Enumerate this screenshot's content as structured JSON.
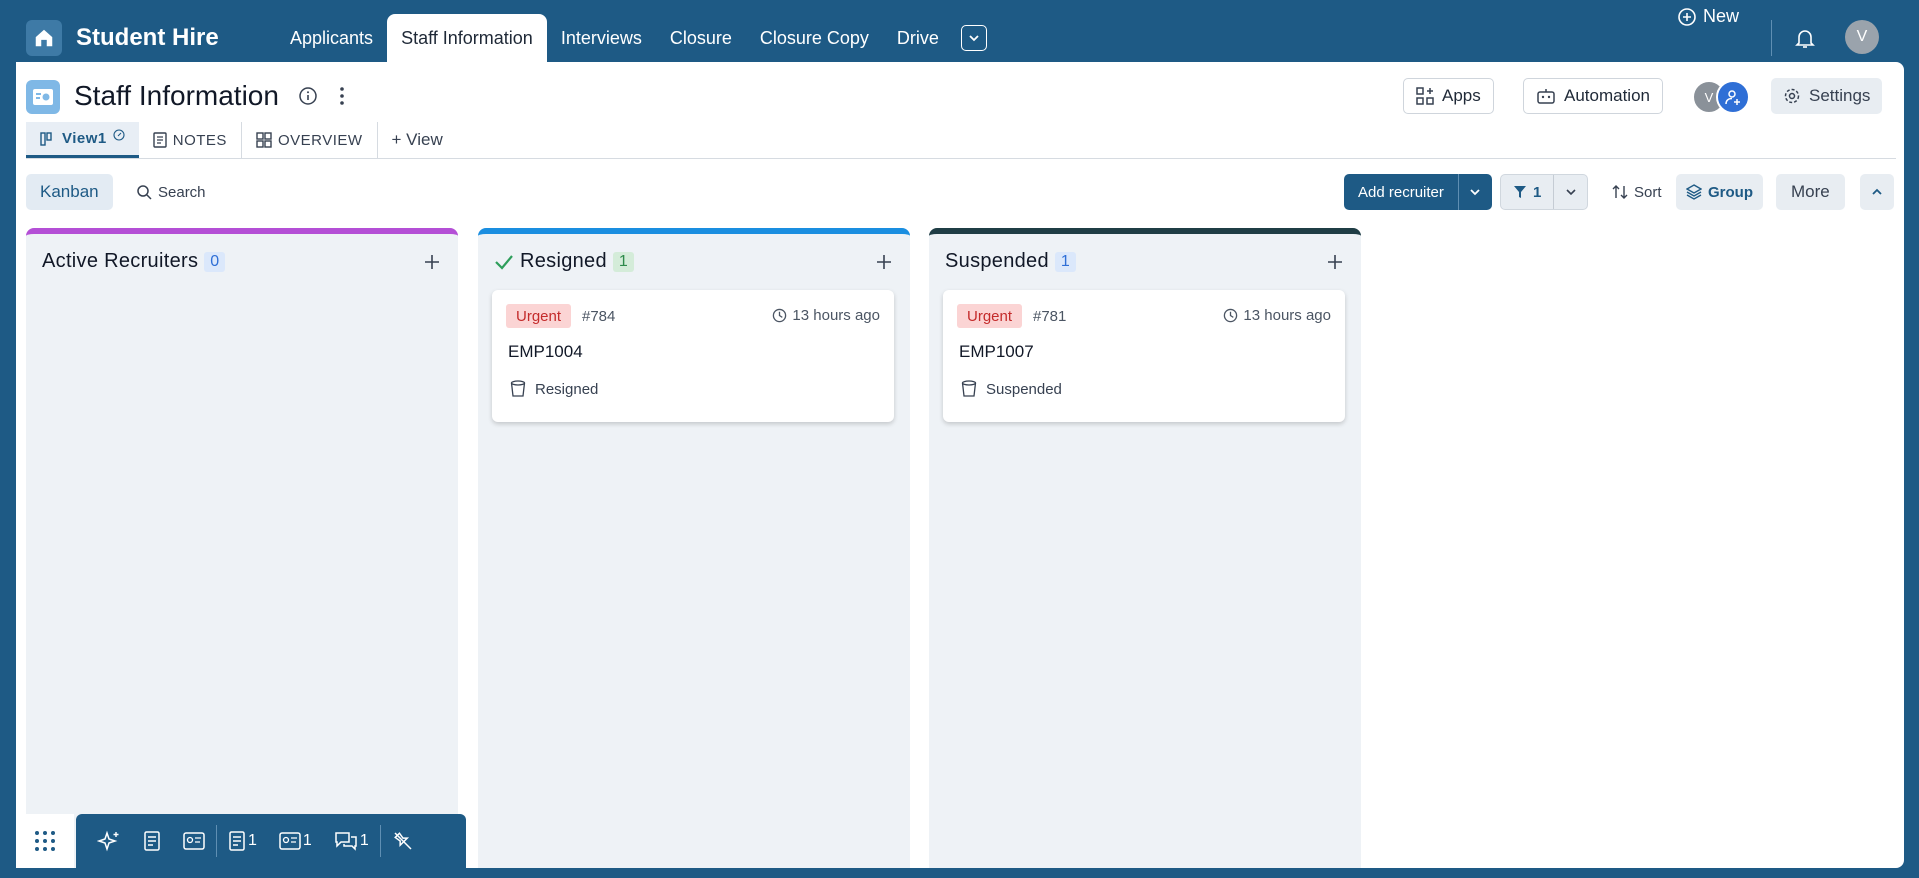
{
  "app": {
    "title": "Student Hire"
  },
  "nav": {
    "tabs": [
      {
        "label": "Applicants"
      },
      {
        "label": "Staff Information"
      },
      {
        "label": "Interviews"
      },
      {
        "label": "Closure"
      },
      {
        "label": "Closure Copy"
      },
      {
        "label": "Drive"
      }
    ],
    "new_label": "New",
    "avatar_initial": "V"
  },
  "page": {
    "title": "Staff Information",
    "apps_label": "Apps",
    "automation_label": "Automation",
    "settings_label": "Settings",
    "avatar_initial": "V"
  },
  "views": {
    "tabs": [
      {
        "label": "View1"
      },
      {
        "label": "NOTES"
      },
      {
        "label": "OVERVIEW"
      }
    ],
    "add_label": "+ View"
  },
  "toolbar": {
    "kanban_label": "Kanban",
    "search_label": "Search",
    "add_label": "Add recruiter",
    "filter_count": "1",
    "sort_label": "Sort",
    "group_label": "Group",
    "more_label": "More"
  },
  "columns": [
    {
      "title": "Active Recruiters",
      "count": "0",
      "color": "#b44fd6",
      "cards": []
    },
    {
      "title": "Resigned",
      "count": "1",
      "color": "#1a8ee0",
      "cards": [
        {
          "priority": "Urgent",
          "number": "#784",
          "time": "13 hours ago",
          "title": "EMP1004",
          "status": "Resigned"
        }
      ]
    },
    {
      "title": "Suspended",
      "count": "1",
      "color": "#1f3d45",
      "cards": [
        {
          "priority": "Urgent",
          "number": "#781",
          "time": "13 hours ago",
          "title": "EMP1007",
          "status": "Suspended"
        }
      ]
    }
  ],
  "bottom_bar": {
    "notes_count": "1",
    "cards_count": "1",
    "comments_count": "1"
  }
}
